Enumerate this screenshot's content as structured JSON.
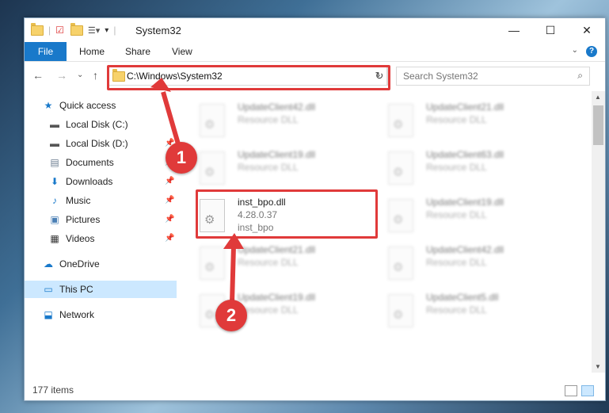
{
  "window": {
    "title": "System32",
    "controls": {
      "minimize": "—",
      "maximize": "☐",
      "close": "✕"
    }
  },
  "ribbon": {
    "tabs": [
      "File",
      "Home",
      "Share",
      "View"
    ],
    "help": "?"
  },
  "nav": {
    "back": "←",
    "forward": "→",
    "recent": "⌄",
    "up": "↑",
    "address": "C:\\Windows\\System32",
    "refresh": "↻",
    "search_placeholder": "Search System32"
  },
  "sidebar": {
    "items": [
      {
        "label": "Quick access",
        "icon": "star-icon"
      },
      {
        "label": "Local Disk (C:)",
        "icon": "drive-icon"
      },
      {
        "label": "Local Disk (D:)",
        "icon": "drive-icon"
      },
      {
        "label": "Documents",
        "icon": "documents-icon"
      },
      {
        "label": "Downloads",
        "icon": "download-icon"
      },
      {
        "label": "Music",
        "icon": "music-icon"
      },
      {
        "label": "Pictures",
        "icon": "pictures-icon"
      },
      {
        "label": "Videos",
        "icon": "videos-icon"
      },
      {
        "label": "OneDrive",
        "icon": "cloud-icon"
      },
      {
        "label": "This PC",
        "icon": "pc-icon"
      },
      {
        "label": "Network",
        "icon": "network-icon"
      }
    ]
  },
  "files": [
    {
      "name": "UpdateClient42.dll",
      "type": "Resource DLL"
    },
    {
      "name": "UpdateClient21.dll",
      "type": "Resource DLL"
    },
    {
      "name": "UpdateClient19.dll",
      "type": "Resource DLL"
    },
    {
      "name": "UpdateClient63.dll",
      "type": "Resource DLL"
    },
    {
      "name": "inst_bpo.dll",
      "version": "4.28.0.37",
      "desc": "inst_bpo"
    },
    {
      "name": "UpdateClient19.dll",
      "type": "Resource DLL"
    },
    {
      "name": "UpdateClient21.dll",
      "type": "Resource DLL"
    },
    {
      "name": "UpdateClient42.dll",
      "type": "Resource DLL"
    },
    {
      "name": "UpdateClient19.dll",
      "type": "Resource DLL"
    },
    {
      "name": "UpdateClient5.dll",
      "type": "Resource DLL"
    }
  ],
  "status": {
    "count": "177 items"
  },
  "annotations": {
    "step1": "1",
    "step2": "2"
  },
  "colors": {
    "accent": "#1979ca",
    "highlight": "#e03a3a",
    "selected": "#cce8ff"
  }
}
